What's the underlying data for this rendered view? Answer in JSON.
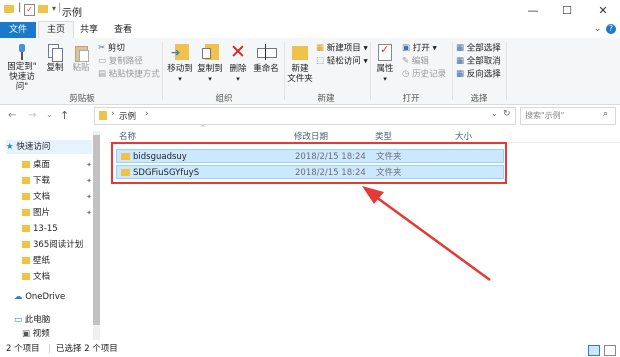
{
  "window": {
    "title": "示例",
    "minimize": "—",
    "maximize": "☐",
    "close": "✕"
  },
  "tabs": {
    "file": "文件",
    "home": "主页",
    "share": "共享",
    "view": "查看"
  },
  "ribbon": {
    "clipboard": {
      "pin": "固定到\"\n快速访问\"",
      "pin_l1": "固定到\"",
      "pin_l2": "快速访问\"",
      "copy": "复制",
      "paste": "粘贴",
      "cut": "剪切",
      "copy_path": "复制路径",
      "paste_shortcut": "粘贴快捷方式",
      "label": "剪贴板"
    },
    "organize": {
      "move_to": "移动到",
      "copy_to": "复制到",
      "delete": "删除",
      "rename": "重命名",
      "label": "组织"
    },
    "new": {
      "new_folder_l1": "新建",
      "new_folder_l2": "文件夹",
      "new_item": "新建项目",
      "easy_access": "轻松访问",
      "label": "新建"
    },
    "open": {
      "properties": "属性",
      "open": "打开",
      "edit": "编辑",
      "history": "历史记录",
      "label": "打开"
    },
    "select": {
      "select_all": "全部选择",
      "select_none": "全部取消",
      "invert": "反向选择",
      "label": "选择"
    }
  },
  "address": {
    "path": "示例",
    "search_placeholder": "搜索\"示例\""
  },
  "nav": {
    "quick_access": "快速访问",
    "items": [
      "桌面",
      "下载",
      "文档",
      "图片",
      "13-15",
      "365阅读计划",
      "壁纸",
      "文档"
    ],
    "onedrive": "OneDrive",
    "this_pc": "此电脑",
    "videos": "视频"
  },
  "columns": {
    "name": "名称",
    "modified": "修改日期",
    "type": "类型",
    "size": "大小"
  },
  "files": [
    {
      "name": "bidsguadsuy",
      "modified": "2018/2/15 18:24",
      "type": "文件夹"
    },
    {
      "name": "SDGFiuSGYfuyS",
      "modified": "2018/2/15 18:24",
      "type": "文件夹"
    }
  ],
  "status": {
    "count": "2 个项目",
    "selected": "已选择 2 个项目"
  },
  "colors": {
    "accent": "#1979ca",
    "selection": "#cce8ff",
    "annotation": "#e53935",
    "folder": "#f1c24a"
  }
}
